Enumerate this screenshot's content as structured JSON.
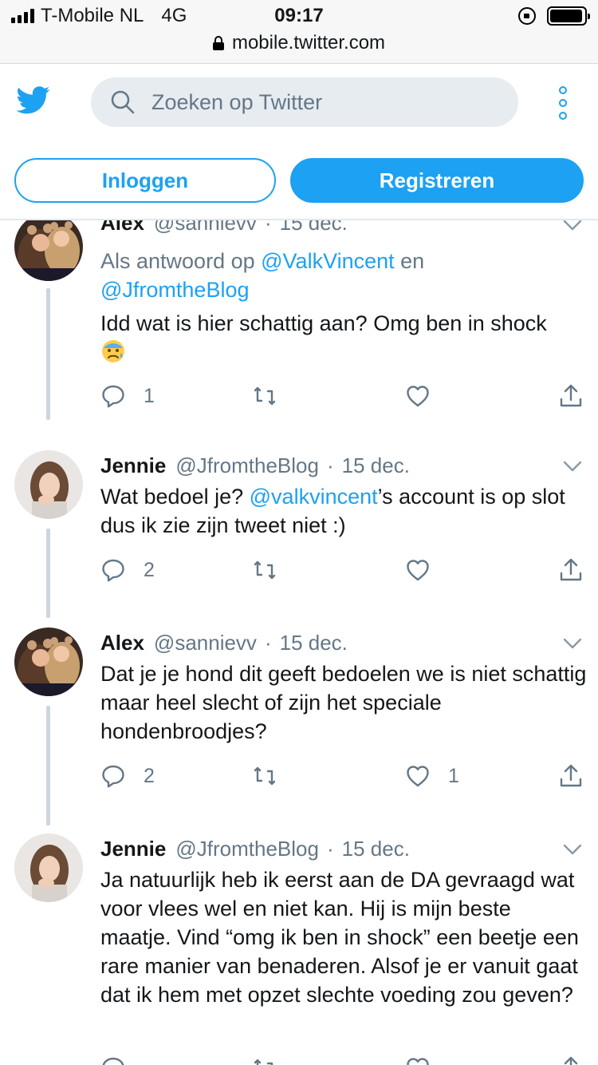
{
  "status_bar": {
    "carrier": "T-Mobile NL",
    "network": "4G",
    "time": "09:17",
    "url": "mobile.twitter.com",
    "battery_level": 0.95
  },
  "header": {
    "logo_icon": "twitter-bird-icon",
    "search": {
      "placeholder": "Zoeken op Twitter",
      "value": ""
    },
    "more_icon": "more-vertical-icon",
    "login_label": "Inloggen",
    "register_label": "Registreren"
  },
  "colors": {
    "accent": "#1da1f2",
    "text": "#14171a",
    "secondary": "#657786",
    "search_bg": "#e6ecf0",
    "thread_line": "#ccd6dd"
  },
  "tweets": [
    {
      "name": "Alex",
      "handle": "@sannievv",
      "separator": "·",
      "date": "15 dec.",
      "reply_prefix": "Als antwoord op",
      "reply_mention_1": "@ValkVincent",
      "reply_and": "en",
      "reply_mention_2": "@JfromtheBlog",
      "text": "Idd wat is hier schattig aan? Omg ben in shock",
      "emoji": "anxious-face-emoji",
      "replies": "1",
      "retweets": "",
      "likes": ""
    },
    {
      "name": "Jennie",
      "handle": "@JfromtheBlog",
      "separator": "·",
      "date": "15 dec.",
      "text_before": "Wat bedoel je?",
      "mention": "@valkvincent",
      "text_after": "’s account is op slot dus ik zie zijn tweet niet :)",
      "replies": "2",
      "retweets": "",
      "likes": ""
    },
    {
      "name": "Alex",
      "handle": "@sannievv",
      "separator": "·",
      "date": "15 dec.",
      "text": "Dat je je hond dit geeft bedoelen we is niet schattig maar heel slecht of zijn het speciale hondenbroodjes?",
      "replies": "2",
      "retweets": "",
      "likes": "1"
    },
    {
      "name": "Jennie",
      "handle": "@JfromtheBlog",
      "separator": "·",
      "date": "15 dec.",
      "text": "Ja natuurlijk heb ik eerst aan de DA gevraagd wat voor vlees wel en niet kan. Hij is mijn beste maatje. Vind “omg ik ben in shock” een beetje een rare manier van benaderen. Alsof je er vanuit gaat dat ik hem met opzet slechte voeding zou geven?",
      "replies": "",
      "retweets": "",
      "likes": ""
    }
  ]
}
